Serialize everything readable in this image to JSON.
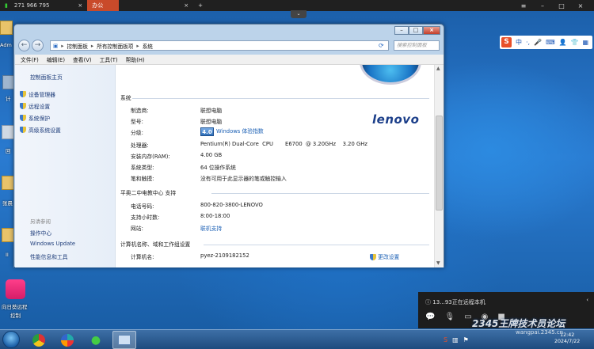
{
  "remote_bar": {
    "connection_label": "271 966 795",
    "active_tab_label": "办公",
    "new_tab": "+"
  },
  "desktop": {
    "icons": [
      {
        "label": "Adm"
      },
      {
        "label": "计"
      },
      {
        "label": "回"
      },
      {
        "label": "张晨"
      },
      {
        "label": "II"
      }
    ],
    "app_label_line1": "向日葵远程",
    "app_label_line2": "控制"
  },
  "ime": {
    "logo": "S",
    "mode": "中"
  },
  "window": {
    "breadcrumb": [
      "控制面板",
      "所有控制面板项",
      "系统"
    ],
    "search_placeholder": "搜索控制面板",
    "menu": [
      "文件(F)",
      "编辑(E)",
      "查看(V)",
      "工具(T)",
      "帮助(H)"
    ],
    "sidebar": {
      "home": "控制面板主页",
      "items": [
        "设备管理器",
        "远程设置",
        "系统保护",
        "高级系统设置"
      ],
      "see_also": "另请参阅",
      "links": [
        "操作中心",
        "Windows Update",
        "性能信息和工具"
      ]
    },
    "system_section": {
      "title": "系统",
      "rows": [
        {
          "label": "制造商:",
          "value": "联想电脑"
        },
        {
          "label": "型号:",
          "value": "联想电脑"
        },
        {
          "label": "分级:",
          "value": "Windows 体验指数",
          "badge": "4.0"
        },
        {
          "label": "处理器:",
          "value": "Pentium(R) Dual-Core  CPU       E6700  @ 3.20GHz    3.20 GHz"
        },
        {
          "label": "安装内存(RAM):",
          "value": "4.00 GB"
        },
        {
          "label": "系统类型:",
          "value": "64 位操作系统"
        },
        {
          "label": "笔和触摸:",
          "value": "没有可用于此显示器的笔或触控输入"
        }
      ],
      "logo": "lenovo"
    },
    "support_section": {
      "title": "平奥二中电教中心 支持",
      "rows": [
        {
          "label": "电话号码:",
          "value": "800-820-3800-LENOVO"
        },
        {
          "label": "支持小时数:",
          "value": "8:00-18:00"
        },
        {
          "label": "网站:",
          "value": "联机支持"
        }
      ]
    },
    "computer_section": {
      "title": "计算机名称、域和工作组设置",
      "rows": [
        {
          "label": "计算机名:",
          "value": "pyez-2109182152"
        }
      ],
      "change_link": "更改设置"
    }
  },
  "notification": {
    "text": "13...93正在远程本机"
  },
  "taskbar": {
    "time": "12:42",
    "date": "2024/7/22"
  },
  "watermark": {
    "line1": "2345王牌技术员论坛",
    "line2": "wangpai.2345.cn"
  }
}
